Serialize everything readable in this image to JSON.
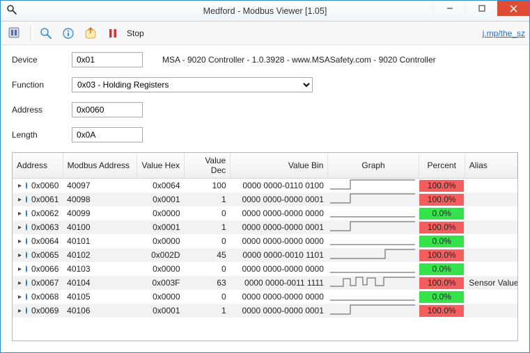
{
  "window": {
    "title": "Medford - Modbus Viewer [1.05]"
  },
  "toolbar": {
    "stop_label": "Stop",
    "link_text": "j.mp/the_sz"
  },
  "form": {
    "device_label": "Device",
    "device_value": "0x01",
    "device_desc": "MSA - 9020 Controller - 1.0.3928 - www.MSASafety.com - 9020 Controller",
    "function_label": "Function",
    "function_value": "0x03 - Holding Registers",
    "address_label": "Address",
    "address_value": "0x0060",
    "length_label": "Length",
    "length_value": "0x0A"
  },
  "columns": {
    "address": "Address",
    "modbus_address": "Modbus Address",
    "value_hex": "Value Hex",
    "value_dec": "Value Dec",
    "value_bin": "Value Bin",
    "graph": "Graph",
    "percent": "Percent",
    "alias": "Alias"
  },
  "rows": [
    {
      "addr": "0x0060",
      "maddr": "40097",
      "vhex": "0x0064",
      "vdec": "100",
      "vbin": "0000 0000-0110 0100",
      "graph": "step-mid",
      "pct": "100.0%",
      "pct_color": "red",
      "alias": ""
    },
    {
      "addr": "0x0061",
      "maddr": "40098",
      "vhex": "0x0001",
      "vdec": "1",
      "vbin": "0000 0000-0000 0001",
      "graph": "step-mid",
      "pct": "100.0%",
      "pct_color": "red",
      "alias": ""
    },
    {
      "addr": "0x0062",
      "maddr": "40099",
      "vhex": "0x0000",
      "vdec": "0",
      "vbin": "0000 0000-0000 0000",
      "graph": "flat",
      "pct": "0.0%",
      "pct_color": "green",
      "alias": ""
    },
    {
      "addr": "0x0063",
      "maddr": "40100",
      "vhex": "0x0001",
      "vdec": "1",
      "vbin": "0000 0000-0000 0001",
      "graph": "step-mid",
      "pct": "100.0%",
      "pct_color": "red",
      "alias": ""
    },
    {
      "addr": "0x0064",
      "maddr": "40101",
      "vhex": "0x0000",
      "vdec": "0",
      "vbin": "0000 0000-0000 0000",
      "graph": "flat",
      "pct": "0.0%",
      "pct_color": "green",
      "alias": ""
    },
    {
      "addr": "0x0065",
      "maddr": "40102",
      "vhex": "0x002D",
      "vdec": "45",
      "vbin": "0000 0000-0010 1101",
      "graph": "step-late",
      "pct": "100.0%",
      "pct_color": "red",
      "alias": ""
    },
    {
      "addr": "0x0066",
      "maddr": "40103",
      "vhex": "0x0000",
      "vdec": "0",
      "vbin": "0000 0000-0000 0000",
      "graph": "flat",
      "pct": "0.0%",
      "pct_color": "green",
      "alias": ""
    },
    {
      "addr": "0x0067",
      "maddr": "40104",
      "vhex": "0x003F",
      "vdec": "63",
      "vbin": "0000 0000-0011 1111",
      "graph": "noisy",
      "pct": "100.0%",
      "pct_color": "red",
      "alias": "Sensor Value"
    },
    {
      "addr": "0x0068",
      "maddr": "40105",
      "vhex": "0x0000",
      "vdec": "0",
      "vbin": "0000 0000-0000 0000",
      "graph": "flat",
      "pct": "0.0%",
      "pct_color": "green",
      "alias": ""
    },
    {
      "addr": "0x0069",
      "maddr": "40106",
      "vhex": "0x0001",
      "vdec": "1",
      "vbin": "0000 0000-0000 0001",
      "graph": "step-mid",
      "pct": "100.0%",
      "pct_color": "red",
      "alias": ""
    }
  ]
}
